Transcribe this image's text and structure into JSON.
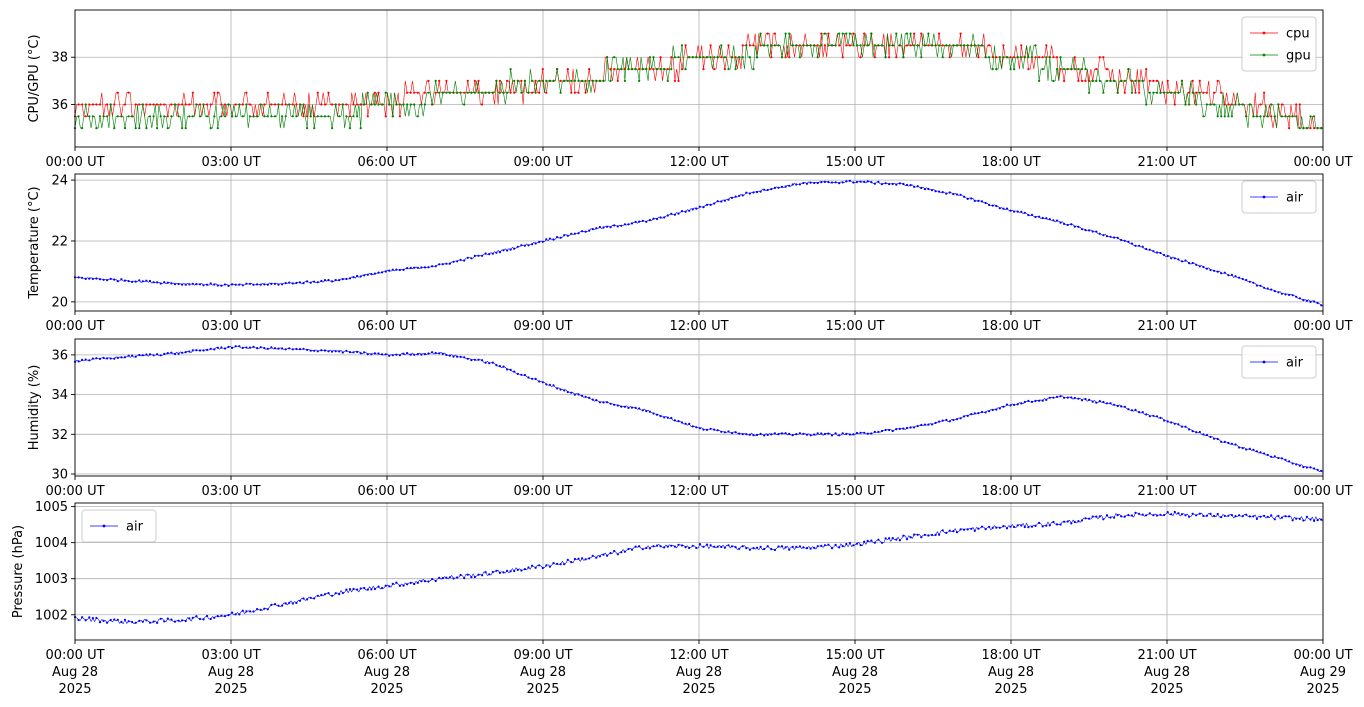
{
  "chart_data": [
    {
      "type": "line",
      "title": "",
      "xlabel": "",
      "ylabel": "CPU/GPU (°C)",
      "xlim": [
        "2025-08-28 00:00",
        "2025-08-29 00:00"
      ],
      "ylim": [
        34.2,
        40.0
      ],
      "yticks": [
        36,
        38
      ],
      "xtick_labels": [
        "00:00 UT",
        "03:00 UT",
        "06:00 UT",
        "09:00 UT",
        "12:00 UT",
        "15:00 UT",
        "18:00 UT",
        "21:00 UT",
        "00:00 UT"
      ],
      "grid": true,
      "legend": "upper right",
      "x": [
        "00:00",
        "01:00",
        "02:00",
        "03:00",
        "04:00",
        "05:00",
        "06:00",
        "07:00",
        "08:00",
        "09:00",
        "10:00",
        "11:00",
        "12:00",
        "13:00",
        "14:00",
        "15:00",
        "16:00",
        "17:00",
        "18:00",
        "19:00",
        "20:00",
        "21:00",
        "22:00",
        "23:00",
        "24:00"
      ],
      "series": [
        {
          "name": "cpu",
          "color": "#ff0000",
          "values": [
            35.9,
            35.9,
            35.9,
            35.9,
            35.9,
            35.9,
            36.2,
            36.4,
            36.5,
            36.8,
            37.2,
            37.5,
            37.9,
            38.3,
            38.5,
            38.6,
            38.6,
            38.5,
            38.1,
            37.7,
            37.2,
            36.7,
            36.3,
            35.7,
            34.9
          ]
        },
        {
          "name": "gpu",
          "color": "#008000",
          "values": [
            35.6,
            35.6,
            35.6,
            35.6,
            35.6,
            35.6,
            35.9,
            36.4,
            36.6,
            37.0,
            37.2,
            37.5,
            38.0,
            38.2,
            38.5,
            38.6,
            38.6,
            38.5,
            38.0,
            37.5,
            37.0,
            36.5,
            36.0,
            35.5,
            35.0
          ]
        }
      ]
    },
    {
      "type": "line",
      "title": "",
      "xlabel": "",
      "ylabel": "Temperature (°C)",
      "xlim": [
        "2025-08-28 00:00",
        "2025-08-29 00:00"
      ],
      "ylim": [
        19.7,
        24.2
      ],
      "yticks": [
        20,
        22,
        24
      ],
      "xtick_labels": [
        "00:00 UT",
        "03:00 UT",
        "06:00 UT",
        "09:00 UT",
        "12:00 UT",
        "15:00 UT",
        "18:00 UT",
        "21:00 UT",
        "00:00 UT"
      ],
      "grid": true,
      "legend": "upper right",
      "x": [
        "00:00",
        "01:00",
        "02:00",
        "03:00",
        "04:00",
        "05:00",
        "06:00",
        "07:00",
        "08:00",
        "09:00",
        "10:00",
        "11:00",
        "12:00",
        "13:00",
        "14:00",
        "15:00",
        "16:00",
        "17:00",
        "18:00",
        "19:00",
        "20:00",
        "21:00",
        "22:00",
        "23:00",
        "24:00"
      ],
      "series": [
        {
          "name": "air",
          "color": "#0000ff",
          "values": [
            20.8,
            20.7,
            20.6,
            20.55,
            20.6,
            20.7,
            21.0,
            21.2,
            21.6,
            22.0,
            22.4,
            22.65,
            23.1,
            23.6,
            23.9,
            23.95,
            23.85,
            23.5,
            23.0,
            22.6,
            22.1,
            21.5,
            21.0,
            20.4,
            19.9
          ]
        }
      ]
    },
    {
      "type": "line",
      "title": "",
      "xlabel": "",
      "ylabel": "Humidity (%)",
      "xlim": [
        "2025-08-28 00:00",
        "2025-08-29 00:00"
      ],
      "ylim": [
        29.9,
        36.8
      ],
      "yticks": [
        30,
        32,
        34,
        36
      ],
      "xtick_labels": [
        "00:00 UT",
        "03:00 UT",
        "06:00 UT",
        "09:00 UT",
        "12:00 UT",
        "15:00 UT",
        "18:00 UT",
        "21:00 UT",
        "00:00 UT"
      ],
      "grid": true,
      "legend": "upper right",
      "x": [
        "00:00",
        "01:00",
        "02:00",
        "03:00",
        "04:00",
        "05:00",
        "06:00",
        "07:00",
        "08:00",
        "09:00",
        "10:00",
        "11:00",
        "12:00",
        "13:00",
        "14:00",
        "15:00",
        "16:00",
        "17:00",
        "18:00",
        "19:00",
        "20:00",
        "21:00",
        "22:00",
        "23:00",
        "24:00"
      ],
      "series": [
        {
          "name": "air",
          "color": "#0000ff",
          "values": [
            35.7,
            35.9,
            36.1,
            36.4,
            36.3,
            36.2,
            36.0,
            36.1,
            35.6,
            34.6,
            33.7,
            33.2,
            32.3,
            32.0,
            32.0,
            32.0,
            32.3,
            32.8,
            33.5,
            33.9,
            33.5,
            32.7,
            31.7,
            30.9,
            30.1
          ]
        }
      ]
    },
    {
      "type": "line",
      "title": "",
      "xlabel": "",
      "ylabel": "Pressure (hPa)",
      "xlim": [
        "2025-08-28 00:00",
        "2025-08-29 00:00"
      ],
      "ylim": [
        1001.3,
        1005.1
      ],
      "yticks": [
        1002,
        1003,
        1004,
        1005
      ],
      "xtick_labels": [
        "00:00 UT",
        "03:00 UT",
        "06:00 UT",
        "09:00 UT",
        "12:00 UT",
        "15:00 UT",
        "18:00 UT",
        "21:00 UT",
        "00:00 UT"
      ],
      "xtick_date_line1": [
        "Aug 28",
        "Aug 28",
        "Aug 28",
        "Aug 28",
        "Aug 28",
        "Aug 28",
        "Aug 28",
        "Aug 28",
        "Aug 29"
      ],
      "xtick_date_line2": [
        "2025",
        "2025",
        "2025",
        "2025",
        "2025",
        "2025",
        "2025",
        "2025",
        "2025"
      ],
      "grid": true,
      "legend": "upper left",
      "x": [
        "00:00",
        "01:00",
        "02:00",
        "03:00",
        "04:00",
        "05:00",
        "06:00",
        "07:00",
        "08:00",
        "09:00",
        "10:00",
        "11:00",
        "12:00",
        "13:00",
        "14:00",
        "15:00",
        "16:00",
        "17:00",
        "18:00",
        "19:00",
        "20:00",
        "21:00",
        "22:00",
        "23:00",
        "24:00"
      ],
      "series": [
        {
          "name": "air",
          "color": "#0000ff",
          "values": [
            1001.9,
            1001.8,
            1001.85,
            1002.0,
            1002.3,
            1002.6,
            1002.8,
            1003.0,
            1003.15,
            1003.35,
            1003.6,
            1003.9,
            1003.9,
            1003.85,
            1003.85,
            1003.95,
            1004.15,
            1004.35,
            1004.45,
            1004.55,
            1004.75,
            1004.8,
            1004.75,
            1004.7,
            1004.65
          ]
        }
      ]
    }
  ]
}
